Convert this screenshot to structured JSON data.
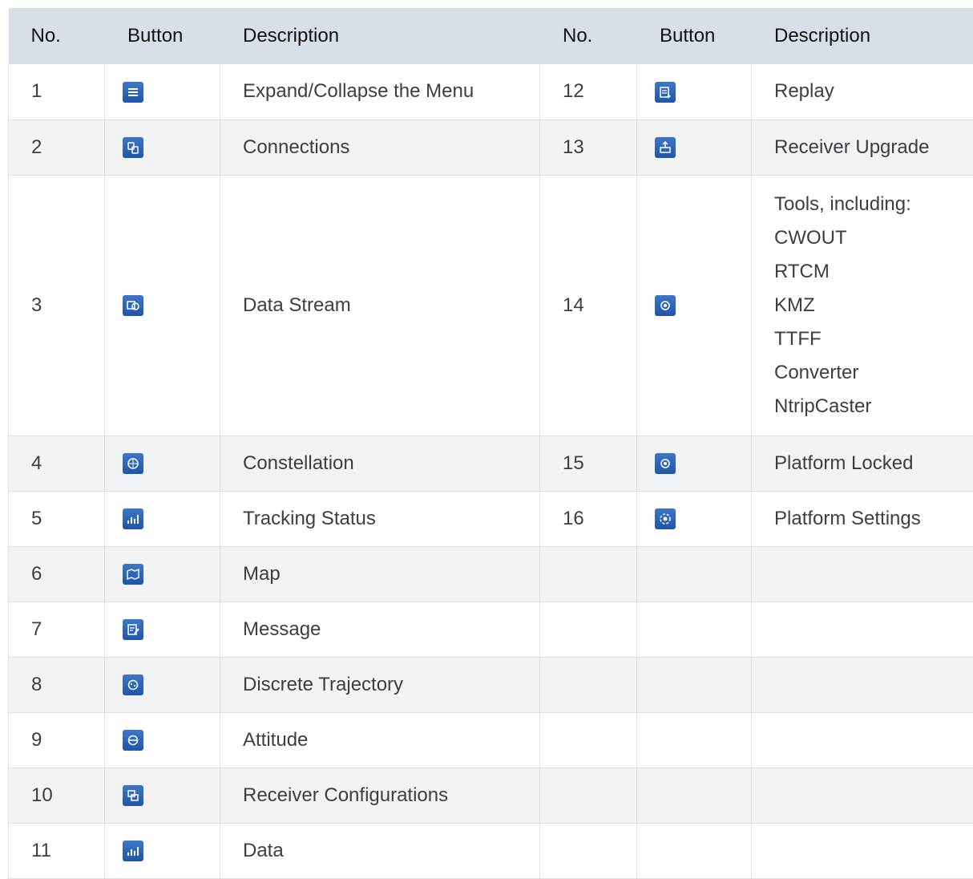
{
  "headers": [
    "No.",
    "Button",
    "Description",
    "No.",
    "Button",
    "Description"
  ],
  "left_rows": [
    {
      "no": "1",
      "icon": "menu-icon",
      "desc": "Expand/Collapse the Menu"
    },
    {
      "no": "2",
      "icon": "connections-icon",
      "desc": "Connections"
    },
    {
      "no": "3",
      "icon": "data-stream-icon",
      "desc": "Data Stream"
    },
    {
      "no": "4",
      "icon": "constellation-icon",
      "desc": "Constellation"
    },
    {
      "no": "5",
      "icon": "tracking-status-icon",
      "desc": "Tracking Status"
    },
    {
      "no": "6",
      "icon": "map-icon",
      "desc": "Map"
    },
    {
      "no": "7",
      "icon": "message-icon",
      "desc": "Message"
    },
    {
      "no": "8",
      "icon": "discrete-trajectory-icon",
      "desc": "Discrete Trajectory"
    },
    {
      "no": "9",
      "icon": "attitude-icon",
      "desc": "Attitude"
    },
    {
      "no": "10",
      "icon": "receiver-configurations-icon",
      "desc": "Receiver Configurations"
    },
    {
      "no": "11",
      "icon": "data-icon",
      "desc": "Data"
    }
  ],
  "right_rows": [
    {
      "no": "12",
      "icon": "replay-icon",
      "desc": "Replay"
    },
    {
      "no": "13",
      "icon": "receiver-upgrade-icon",
      "desc": "Receiver Upgrade"
    },
    {
      "no": "14",
      "icon": "tools-icon",
      "desc_lines": [
        "Tools, including:",
        "CWOUT",
        "RTCM",
        "KMZ",
        "TTFF",
        "Converter",
        "NtripCaster"
      ]
    },
    {
      "no": "15",
      "icon": "platform-locked-icon",
      "desc": "Platform Locked"
    },
    {
      "no": "16",
      "icon": "platform-settings-icon",
      "desc": "Platform Settings"
    }
  ],
  "colors": {
    "header_bg": "#d9dfe6",
    "stripe_bg": "#f2f3f4",
    "icon_blue": "#2a62b6"
  }
}
